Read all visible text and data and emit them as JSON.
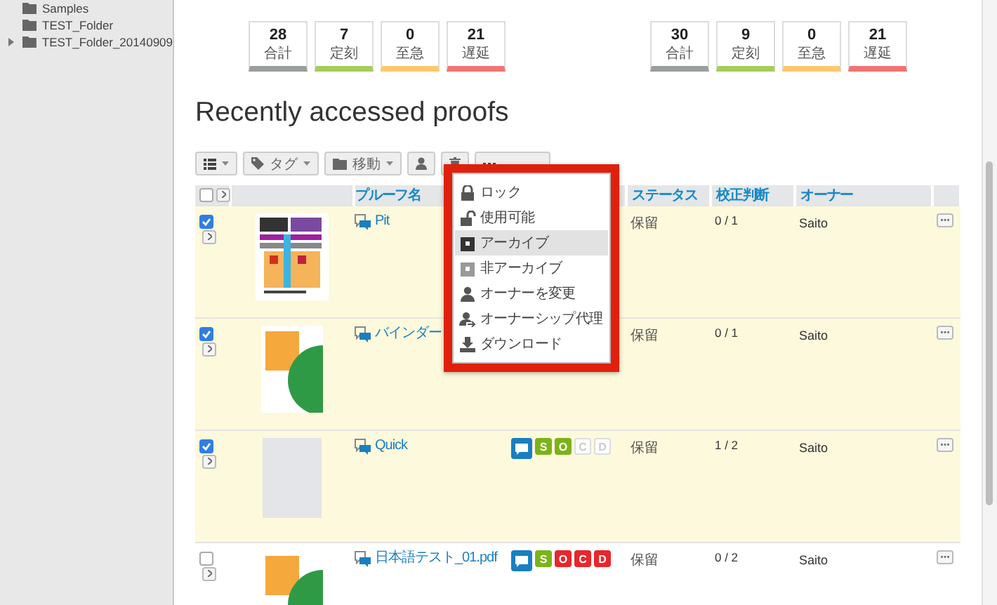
{
  "sidebar": {
    "items": [
      {
        "label": "Samples"
      },
      {
        "label": "TEST_Folder"
      },
      {
        "label": "TEST_Folder_20140909",
        "expanded": false
      }
    ]
  },
  "stat_groups": [
    {
      "items": [
        {
          "value": "28",
          "label": "合計",
          "color": "#9a9e9e"
        },
        {
          "value": "7",
          "label": "定刻",
          "color": "#a6cc5c"
        },
        {
          "value": "0",
          "label": "至急",
          "color": "#ffc76e"
        },
        {
          "value": "21",
          "label": "遅延",
          "color": "#f47272"
        }
      ]
    },
    {
      "items": [
        {
          "value": "30",
          "label": "合計",
          "color": "#9a9e9e"
        },
        {
          "value": "9",
          "label": "定刻",
          "color": "#a6cc5c"
        },
        {
          "value": "0",
          "label": "至急",
          "color": "#ffc76e"
        },
        {
          "value": "21",
          "label": "遅延",
          "color": "#f47272"
        }
      ]
    }
  ],
  "heading": "Recently accessed proofs",
  "toolbar": {
    "tag_button": "タグ",
    "move_button": "移動"
  },
  "table": {
    "all_selected": false,
    "columns": [
      "プルーフ名",
      "ステータス",
      "校正判断",
      "オーナー"
    ],
    "rows": [
      {
        "selected": true,
        "thumbnail": {
          "kind": "colorful"
        },
        "name": "Pit",
        "badges": [],
        "status": "保留",
        "judgement": "0 / 1",
        "owner": "Saito"
      },
      {
        "selected": true,
        "thumbnail": {
          "kind": "shapes"
        },
        "name": "バインダー",
        "badges": [],
        "status": "保留",
        "judgement": "0 / 1",
        "owner": "Saito"
      },
      {
        "selected": true,
        "thumbnail": {
          "kind": "blank"
        },
        "name": "Quick",
        "badges": [
          {
            "kind": "comment"
          },
          {
            "kind": "letter",
            "letter": "S",
            "disabled": false,
            "color": "#7bb31a"
          },
          {
            "kind": "letter",
            "letter": "O",
            "disabled": false,
            "color": "#7bb31a"
          },
          {
            "kind": "letter",
            "letter": "C",
            "disabled": true
          },
          {
            "kind": "letter",
            "letter": "D",
            "disabled": true
          }
        ],
        "status": "保留",
        "judgement": "1 / 2",
        "owner": "Saito"
      },
      {
        "selected": false,
        "thumbnail": {
          "kind": "shapes"
        },
        "name": "日本語テスト_01.pdf",
        "badges": [
          {
            "kind": "comment"
          },
          {
            "kind": "letter",
            "letter": "S",
            "disabled": false,
            "color": "#7bb31a"
          },
          {
            "kind": "letter",
            "letter": "O",
            "disabled": false,
            "color": "#e9262b"
          },
          {
            "kind": "letter",
            "letter": "C",
            "disabled": false,
            "color": "#e9262b"
          },
          {
            "kind": "letter",
            "letter": "D",
            "disabled": false,
            "color": "#e9262b"
          }
        ],
        "status": "保留",
        "judgement": "0 / 2",
        "owner": "Saito"
      }
    ]
  },
  "menu": {
    "items": [
      {
        "kind": "lock",
        "label": "ロック",
        "selected": false
      },
      {
        "kind": "unlock",
        "label": "使用可能",
        "selected": false
      },
      {
        "kind": "archive",
        "label": "アーカイブ",
        "selected": true
      },
      {
        "kind": "unarchive",
        "label": "非アーカイブ",
        "selected": false
      },
      {
        "kind": "owner",
        "label": "オーナーを変更",
        "selected": false
      },
      {
        "kind": "proxy",
        "label": "オーナーシップ代理",
        "selected": false
      },
      {
        "kind": "download",
        "label": "ダウンロード",
        "selected": false
      }
    ]
  }
}
